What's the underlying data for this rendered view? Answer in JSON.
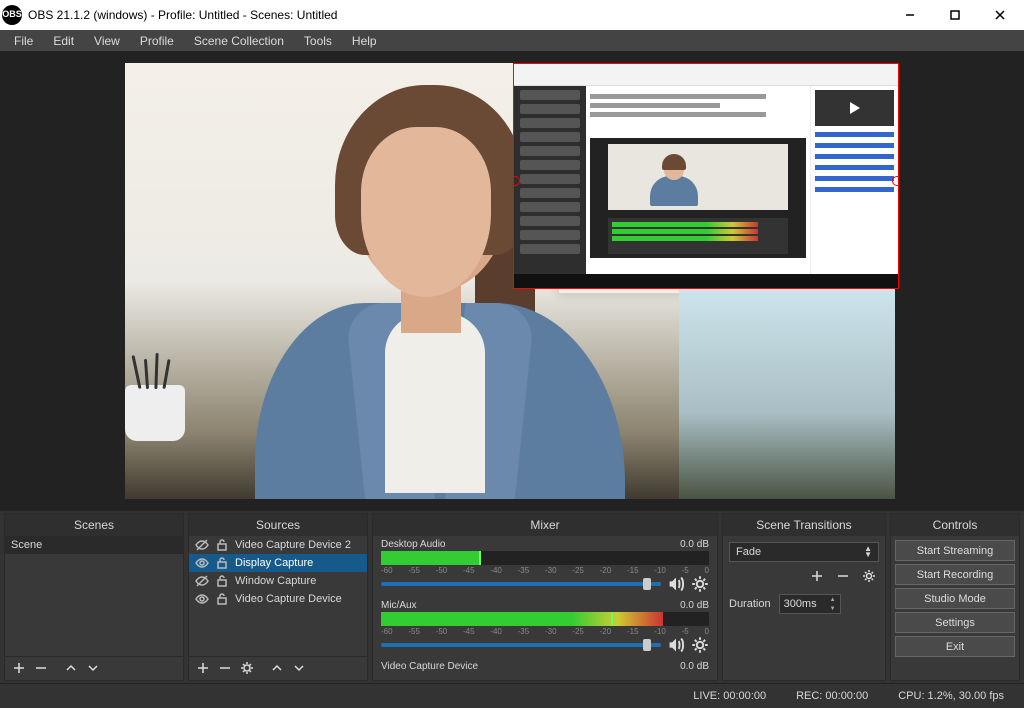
{
  "window": {
    "title": "OBS 21.1.2 (windows) - Profile: Untitled - Scenes: Untitled"
  },
  "menu": {
    "file": "File",
    "edit": "Edit",
    "view": "View",
    "profile": "Profile",
    "scene_collection": "Scene Collection",
    "tools": "Tools",
    "help": "Help"
  },
  "panels": {
    "scenes": {
      "title": "Scenes",
      "items": [
        "Scene"
      ]
    },
    "sources": {
      "title": "Sources",
      "items": [
        {
          "label": "Video Capture Device 2",
          "visible": false,
          "locked": false
        },
        {
          "label": "Display Capture",
          "visible": true,
          "locked": false,
          "selected": true
        },
        {
          "label": "Window Capture",
          "visible": false,
          "locked": false
        },
        {
          "label": "Video Capture Device",
          "visible": true,
          "locked": false
        }
      ]
    },
    "mixer": {
      "title": "Mixer",
      "ticks": [
        "-60",
        "-55",
        "-50",
        "-45",
        "-40",
        "-35",
        "-30",
        "-25",
        "-20",
        "-15",
        "-10",
        "-5",
        "0"
      ],
      "channels": [
        {
          "name": "Desktop Audio",
          "db": "0.0 dB"
        },
        {
          "name": "Mic/Aux",
          "db": "0.0 dB"
        },
        {
          "name": "Video Capture Device",
          "db": "0.0 dB"
        }
      ]
    },
    "transitions": {
      "title": "Scene Transitions",
      "current": "Fade",
      "duration_label": "Duration",
      "duration": "300ms"
    },
    "controls": {
      "title": "Controls",
      "start_streaming": "Start Streaming",
      "start_recording": "Start Recording",
      "studio_mode": "Studio Mode",
      "settings": "Settings",
      "exit": "Exit"
    }
  },
  "status": {
    "live": "LIVE: 00:00:00",
    "rec": "REC: 00:00:00",
    "cpu": "CPU: 1.2%, 30.00 fps"
  }
}
